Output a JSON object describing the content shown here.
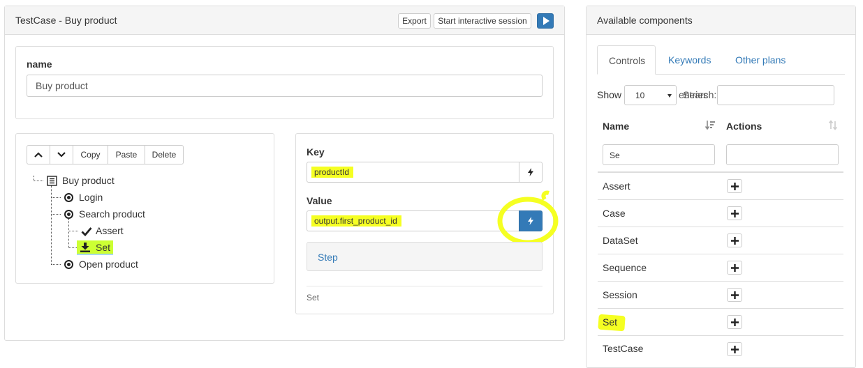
{
  "testcase_panel": {
    "title": "TestCase - Buy product",
    "export_label": "Export",
    "interactive_label": "Start interactive session",
    "play_icon": "play-icon"
  },
  "name_section": {
    "label": "name",
    "value": "Buy product"
  },
  "tree_toolbar": {
    "up_icon": "chevron-up-icon",
    "down_icon": "chevron-down-icon",
    "copy_label": "Copy",
    "paste_label": "Paste",
    "delete_label": "Delete"
  },
  "tree": {
    "root": "Buy product",
    "login": "Login",
    "search": "Search product",
    "assert": "Assert",
    "set": "Set",
    "open": "Open product"
  },
  "properties": {
    "key_label": "Key",
    "key_value": "productId",
    "value_label": "Value",
    "value_value": "output.first_product_id",
    "step_label": "Step",
    "type_text": "Set",
    "bolt_icon": "bolt-icon"
  },
  "components": {
    "title": "Available components",
    "tabs": [
      "Controls",
      "Keywords",
      "Other plans"
    ],
    "show_label": "Show",
    "show_value": "10",
    "entries_label": "entries",
    "search_label": "Search:",
    "col_name": "Name",
    "col_actions": "Actions",
    "name_filter": "Se",
    "rows": [
      "Assert",
      "Case",
      "DataSet",
      "Sequence",
      "Session",
      "Set",
      "TestCase"
    ]
  },
  "colors": {
    "highlight": "#f5ff22",
    "primary": "#337ab7",
    "link": "#337ab7"
  }
}
